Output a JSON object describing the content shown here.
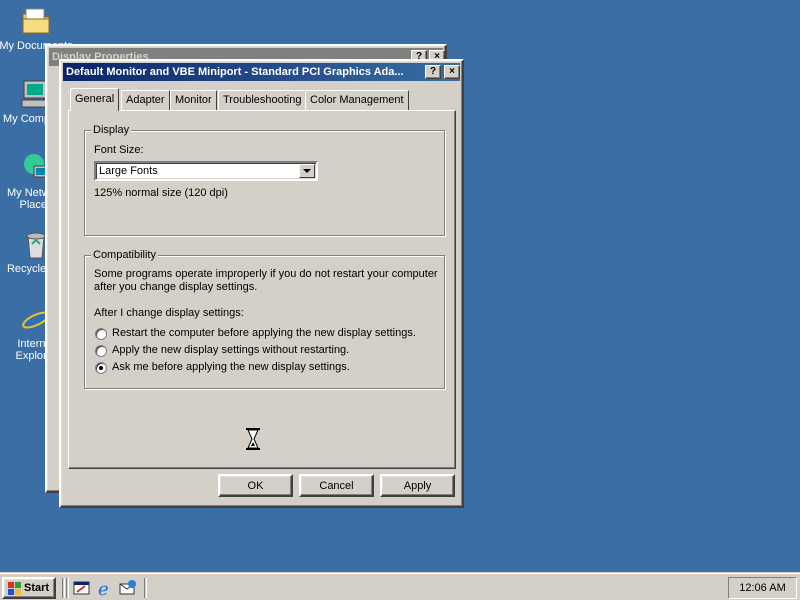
{
  "desktop": {
    "icons": [
      {
        "label": "My Documents",
        "name": "my-documents"
      },
      {
        "label": "My Computer",
        "name": "my-computer"
      },
      {
        "label": "My Network Places",
        "name": "my-network-places"
      },
      {
        "label": "Recycle Bin",
        "name": "recycle-bin"
      },
      {
        "label": "Internet Explorer",
        "name": "internet-explorer"
      }
    ]
  },
  "back_window": {
    "title": "Display Properties"
  },
  "dialog": {
    "title": "Default Monitor and VBE Miniport - Standard PCI Graphics Ada...",
    "help_label": "?",
    "close_label": "×",
    "tabs": [
      {
        "label": "General",
        "active": true
      },
      {
        "label": "Adapter"
      },
      {
        "label": "Monitor"
      },
      {
        "label": "Troubleshooting"
      },
      {
        "label": "Color Management"
      }
    ],
    "display_group": {
      "legend": "Display",
      "font_size_label": "Font Size:",
      "font_size_value": "Large Fonts",
      "font_size_desc": "125% normal size (120 dpi)"
    },
    "compat_group": {
      "legend": "Compatibility",
      "desc_line1": "Some programs operate improperly if you do not restart your computer",
      "desc_line2": "after you change display settings.",
      "after_label": "After I change display settings:",
      "options": [
        {
          "label": "Restart the computer before applying the new display settings.",
          "checked": false
        },
        {
          "label": "Apply the new display settings without restarting.",
          "checked": false
        },
        {
          "label": "Ask me before applying the new display settings.",
          "checked": true
        }
      ]
    },
    "buttons": {
      "ok": "OK",
      "cancel": "Cancel",
      "apply": "Apply"
    }
  },
  "taskbar": {
    "start_label": "Start",
    "clock": "12:06 AM"
  }
}
